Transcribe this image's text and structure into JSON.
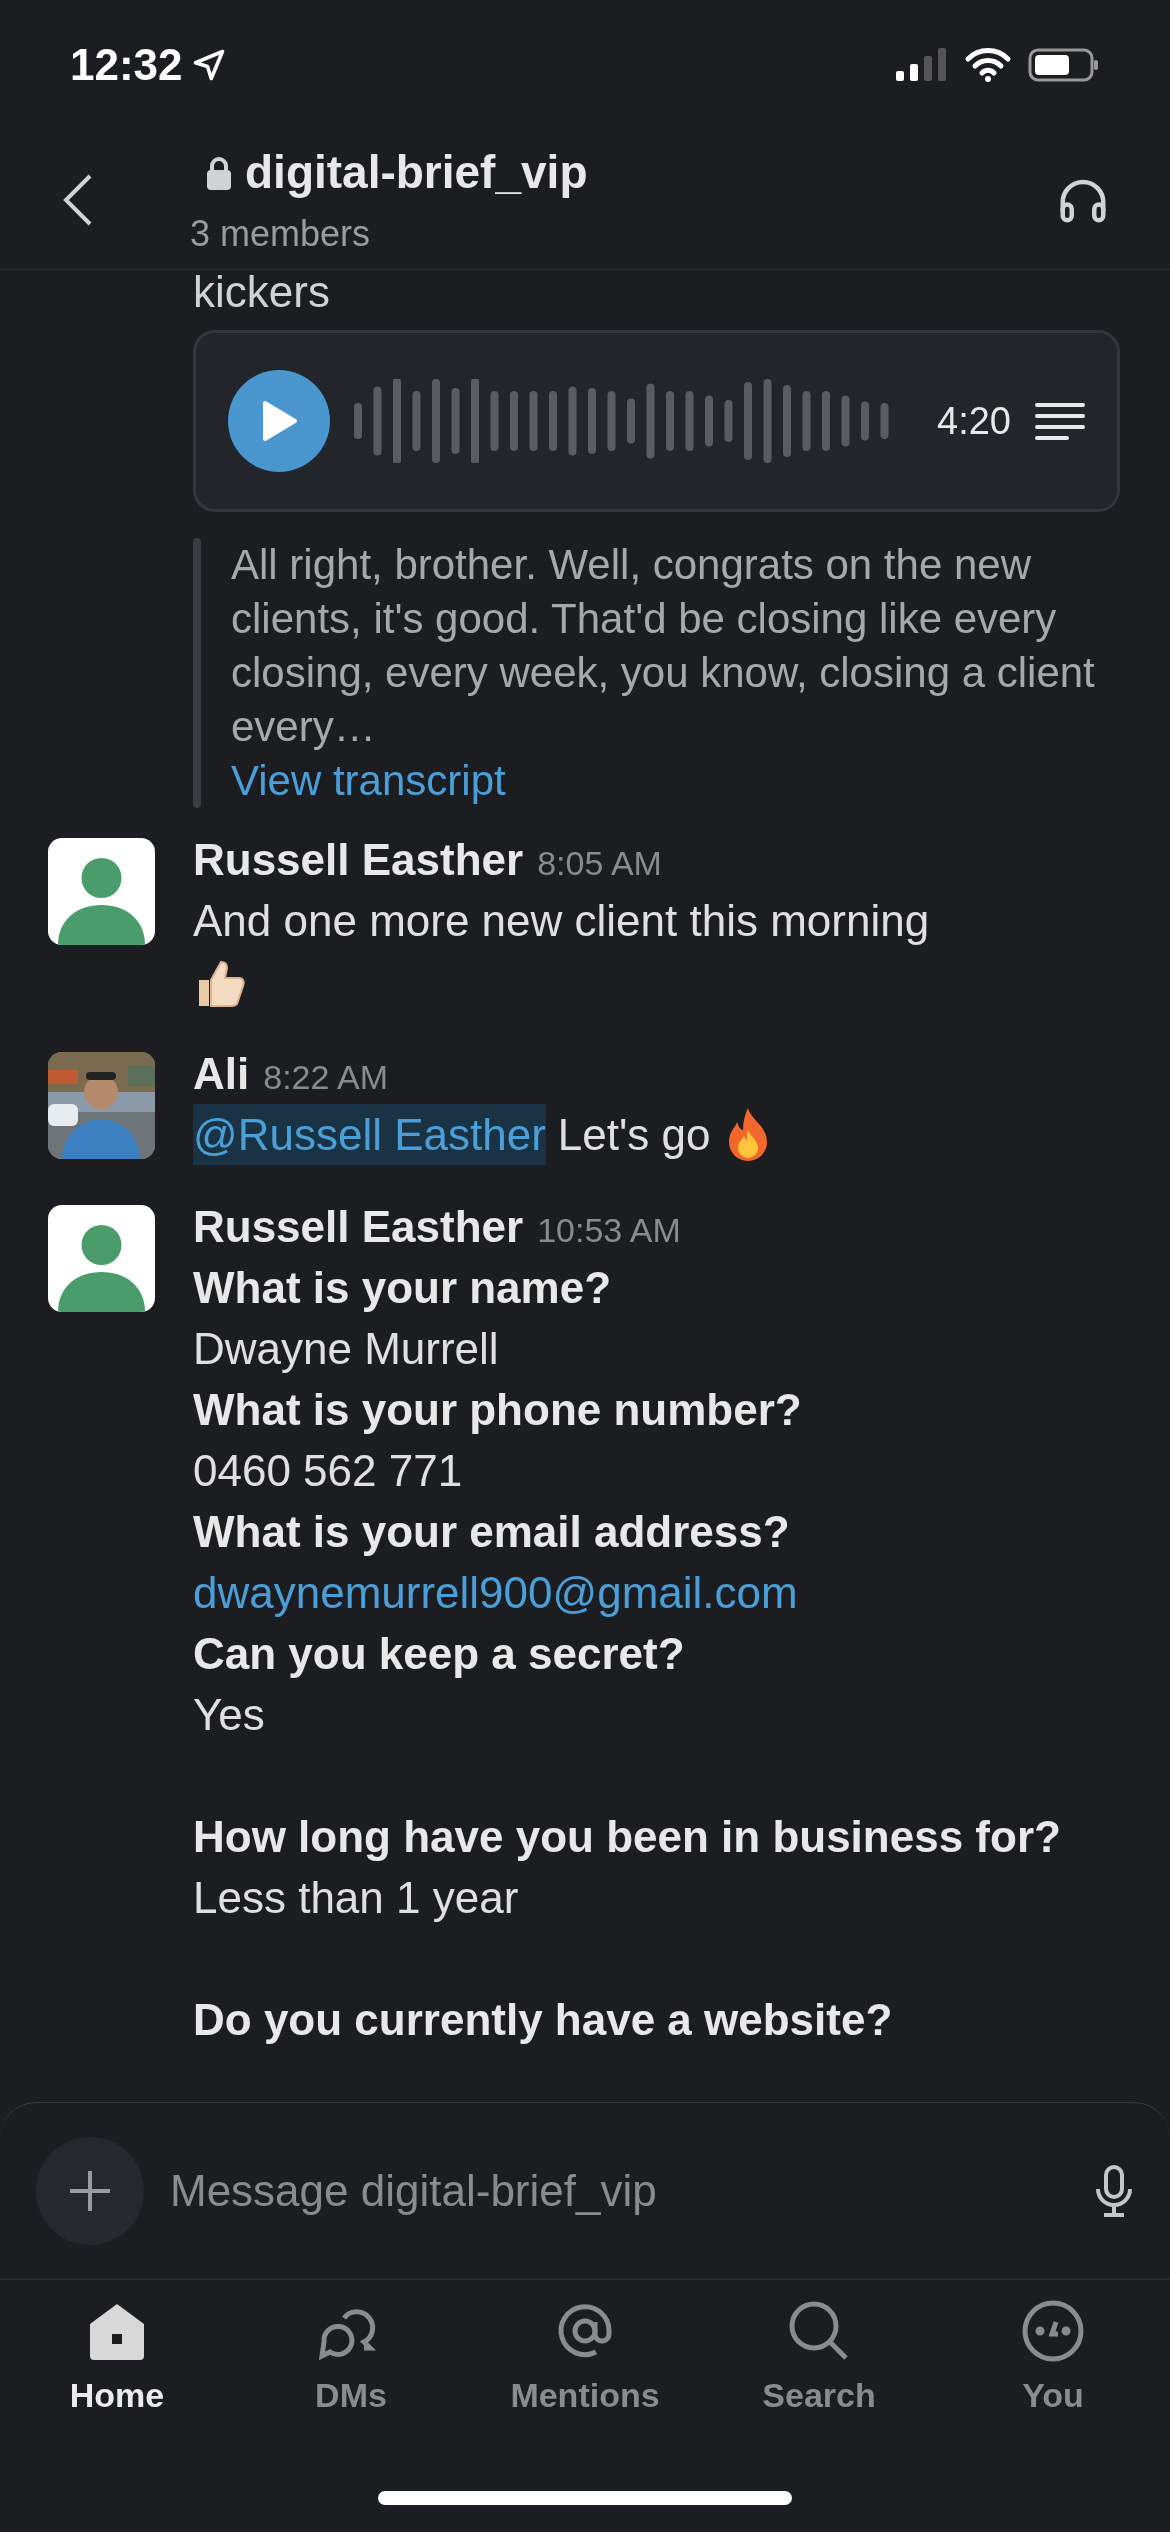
{
  "status_bar": {
    "time": "12:32"
  },
  "header": {
    "channel": "digital-brief_vip",
    "members": "3 members"
  },
  "cut_text": "kickers",
  "voice_clip": {
    "duration": "4:20",
    "transcript": "All right, brother. Well, congrats on the new clients, it's good. That'd be closing like every closing, every week, you know, closing a client every…",
    "link": "View transcript"
  },
  "messages": [
    {
      "author": "Russell Easther",
      "time": "8:05 AM",
      "lines": [
        {
          "kind": "text",
          "text": "And one more new client this morning"
        }
      ]
    },
    {
      "author": "Ali",
      "time": "8:22 AM",
      "lines": [
        {
          "kind": "mention",
          "mention": "@Russell Easther",
          "text": "Let's go"
        }
      ]
    },
    {
      "author": "Russell Easther",
      "time": "10:53 AM",
      "lines": [
        {
          "kind": "question",
          "text": "What is your name?"
        },
        {
          "kind": "text",
          "text": "Dwayne Murrell"
        },
        {
          "kind": "question",
          "text": "What is your phone number?"
        },
        {
          "kind": "text",
          "text": "0460 562 771"
        },
        {
          "kind": "question",
          "text": "What is your email address?"
        },
        {
          "kind": "email",
          "text": "dwaynemurrell900@gmail.com"
        },
        {
          "kind": "question",
          "text": "Can you keep a secret?"
        },
        {
          "kind": "text",
          "text": "Yes"
        },
        {
          "kind": "question",
          "text": "How long have you been in business for?",
          "gap_before": true
        },
        {
          "kind": "text",
          "text": "Less than 1 year"
        },
        {
          "kind": "question",
          "text": "Do you currently have a website?",
          "gap_before": true
        }
      ]
    }
  ],
  "composer": {
    "placeholder": "Message digital-brief_vip"
  },
  "tabs": [
    {
      "label": "Home",
      "selected": true
    },
    {
      "label": "DMs",
      "selected": false
    },
    {
      "label": "Mentions",
      "selected": false
    },
    {
      "label": "Search",
      "selected": false
    },
    {
      "label": "You",
      "selected": false
    }
  ]
}
